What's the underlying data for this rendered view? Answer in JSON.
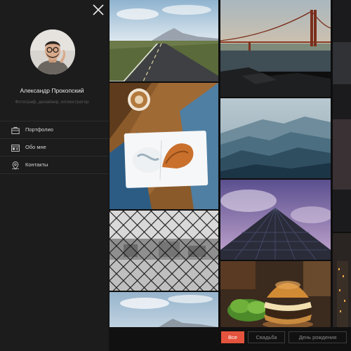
{
  "profile": {
    "name": "Александр Прокопский",
    "subtitle": "Фотограф, дизайнер, иллюстратор"
  },
  "nav": {
    "items": [
      {
        "label": "Портфолио",
        "icon": "briefcase-icon"
      },
      {
        "label": "Обо мне",
        "icon": "profile-card-icon"
      },
      {
        "label": "Контакты",
        "icon": "location-pin-icon"
      }
    ]
  },
  "gallery": {
    "photos": [
      "road-landscape",
      "golden-gate-bridge",
      "coffee-and-dessert-plate",
      "blue-mountain-ridges",
      "chain-link-fence",
      "glass-skyscraper",
      "mountain-sky",
      "burger-and-salad",
      "city-night"
    ]
  },
  "filters": {
    "items": [
      "Все",
      "Свадьба",
      "День рождения"
    ],
    "active": "Все",
    "active_color": "#e4533d"
  },
  "colors": {
    "sidebar_bg": "#1c1c1c",
    "page_bg": "#0e0e0e"
  }
}
